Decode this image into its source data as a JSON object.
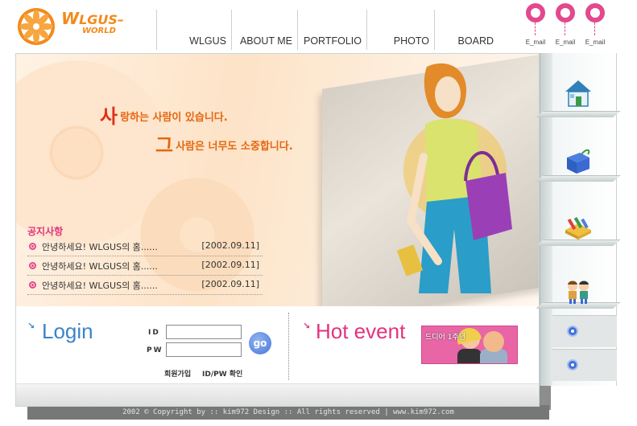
{
  "logo": {
    "line1_initial": "W",
    "line1_rest": "LGUS–",
    "line2": "WORLD",
    "color": "#f28a1a"
  },
  "nav": {
    "items": [
      {
        "label": "WLGUS"
      },
      {
        "label": "ABOUT ME"
      },
      {
        "label": "PORTFOLIO"
      },
      {
        "label": "PHOTO"
      },
      {
        "label": "BOARD"
      }
    ]
  },
  "emails": [
    {
      "label": "E_mail"
    },
    {
      "label": "E_mail"
    },
    {
      "label": "E_mail"
    }
  ],
  "hero": {
    "slogan1_first": "사",
    "slogan1_rest": "랑하는 사람이 있습니다.",
    "slogan2_first": "그",
    "slogan2_rest": "사람은 너무도 소중합니다."
  },
  "notice": {
    "title": "공지사항",
    "items": [
      {
        "title": "안녕하세요! WLGUS의 홈......",
        "date": "[2002.09.11]"
      },
      {
        "title": "안녕하세요! WLGUS의 홈......",
        "date": "[2002.09.11]"
      },
      {
        "title": "안녕하세요! WLGUS의 홈......",
        "date": "[2002.09.11]"
      }
    ]
  },
  "login": {
    "arrow": "↘",
    "title": "Login",
    "id_label": "ID",
    "pw_label": "PW",
    "id_value": "",
    "pw_value": "",
    "go_label": "go",
    "join_label": "회원가입",
    "find_label": "ID/PW 확인"
  },
  "event": {
    "arrow": "↘",
    "title": "Hot event",
    "banner_label": "드디어 1주년"
  },
  "shelf": {
    "icons": [
      "house-icon",
      "gift-box-icon",
      "pencil-box-icon",
      "kids-icon"
    ],
    "buttons": [
      "shelf-dot-button-1",
      "shelf-dot-button-2"
    ]
  },
  "footer": {
    "copyright": "2002 © Copyright by :: kim972 Design :: All rights reserved | www.kim972.com"
  },
  "colors": {
    "accent_pink": "#e2337e",
    "accent_blue": "#3a84c8",
    "accent_orange": "#e5660f"
  }
}
